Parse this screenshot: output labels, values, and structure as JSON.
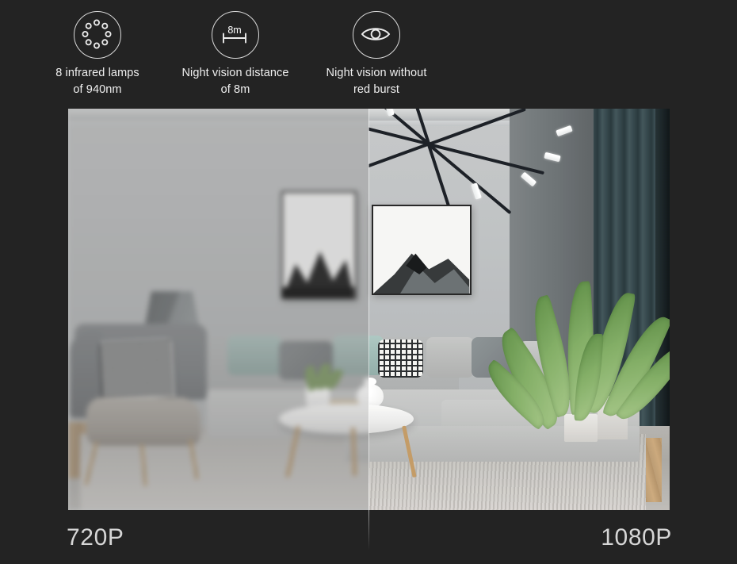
{
  "page": {
    "background_color": "#232323",
    "text_color": "#f0f0f0"
  },
  "features": [
    {
      "icon": "infrared-lamp-ring-icon",
      "label": "8 infrared lamps\nof 940nm",
      "line1": "8 infrared lamps",
      "line2": "of 940nm"
    },
    {
      "icon": "distance-measure-icon",
      "icon_text": "8m",
      "label": "Night vision distance\nof 8m",
      "line1": "Night vision distance",
      "line2": "of 8m"
    },
    {
      "icon": "eye-icon",
      "label": "Night vision without\nred burst",
      "line1": "Night vision without",
      "line2": "red burst"
    }
  ],
  "comparison": {
    "left_label": "720P",
    "right_label": "1080P",
    "scene_description": "Living room interior with sectional sofa, coffee table, chandelier, framed artwork and a plant",
    "divider_color": "#ffffff"
  }
}
